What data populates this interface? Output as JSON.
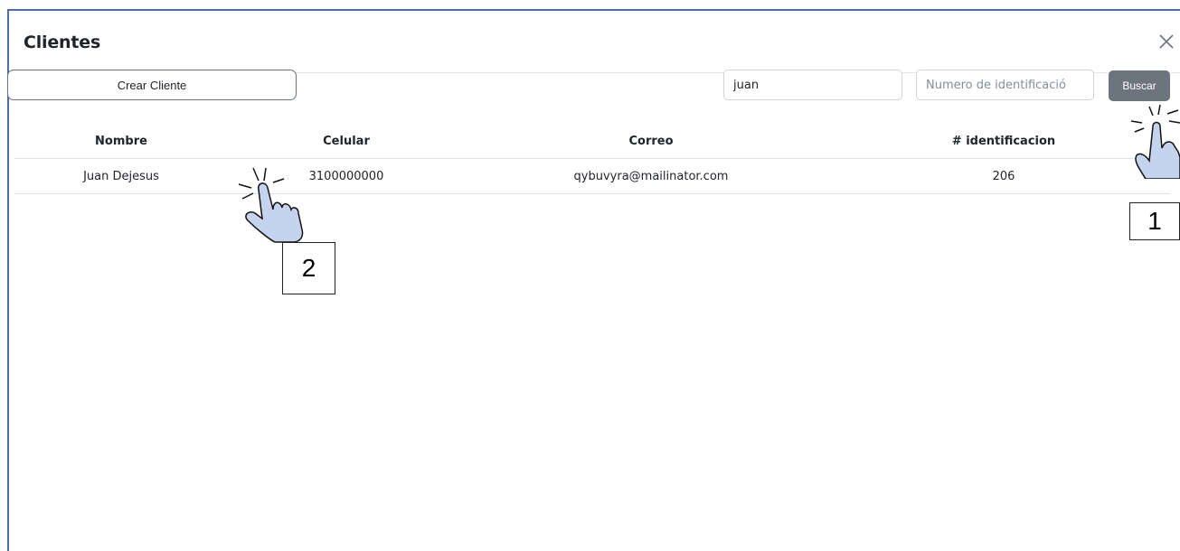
{
  "modal": {
    "title": "Clientes"
  },
  "toolbar": {
    "create_label": "Crear Cliente",
    "name_value": "juan",
    "id_placeholder": "Numero de identificació",
    "search_label": "Buscar"
  },
  "table": {
    "headers": [
      "Nombre",
      "Celular",
      "Correo",
      "# identificacion"
    ],
    "rows": [
      [
        "Juan Dejesus",
        "3100000000",
        "qybuvyra@mailinator.com",
        "206"
      ]
    ]
  },
  "annotations": {
    "step1": "1",
    "step2": "2"
  },
  "icons": {
    "close": "close-icon",
    "pointer": "hand-pointer-icon"
  },
  "colors": {
    "accent_border": "#4a6fa5",
    "search_button": "#6c757d",
    "hand_fill": "#c5d4ee"
  }
}
